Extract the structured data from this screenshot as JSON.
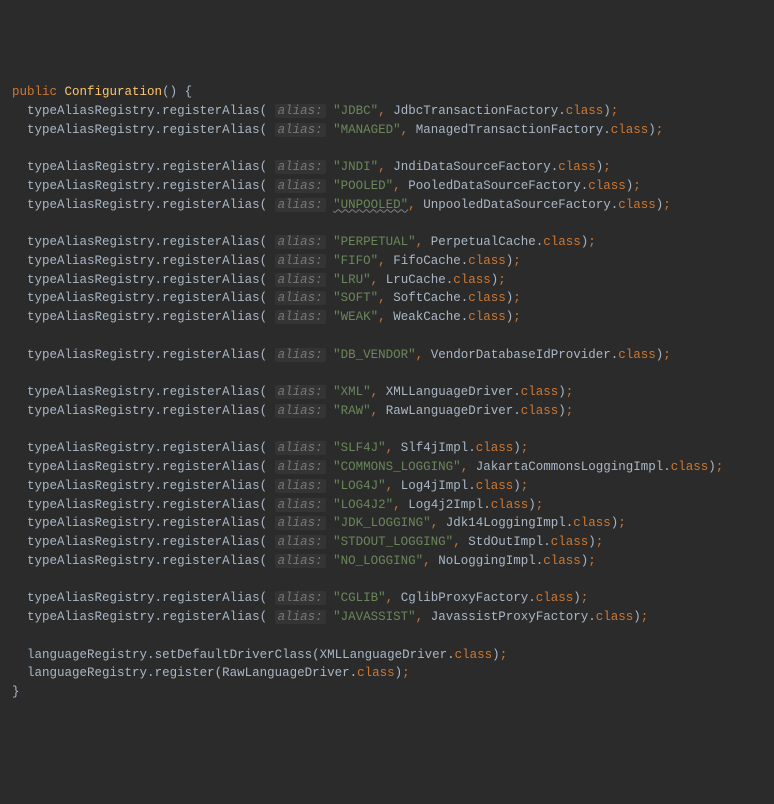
{
  "keywords": {
    "public": "public",
    "class": "class"
  },
  "method": "Configuration",
  "registry": "typeAliasRegistry",
  "langRegistry": "languageRegistry",
  "registerAlias": "registerAlias",
  "setDefaultDriverClass": "setDefaultDriverClass",
  "register": "register",
  "hint": "alias:",
  "lines": [
    {
      "alias": "JDBC",
      "cls": "JdbcTransactionFactory"
    },
    {
      "alias": "MANAGED",
      "cls": "ManagedTransactionFactory"
    },
    null,
    {
      "alias": "JNDI",
      "cls": "JndiDataSourceFactory"
    },
    {
      "alias": "POOLED",
      "cls": "PooledDataSourceFactory"
    },
    {
      "alias": "UNPOOLED",
      "cls": "UnpooledDataSourceFactory",
      "underline": true
    },
    null,
    {
      "alias": "PERPETUAL",
      "cls": "PerpetualCache"
    },
    {
      "alias": "FIFO",
      "cls": "FifoCache"
    },
    {
      "alias": "LRU",
      "cls": "LruCache"
    },
    {
      "alias": "SOFT",
      "cls": "SoftCache"
    },
    {
      "alias": "WEAK",
      "cls": "WeakCache"
    },
    null,
    {
      "alias": "DB_VENDOR",
      "cls": "VendorDatabaseIdProvider"
    },
    null,
    {
      "alias": "XML",
      "cls": "XMLLanguageDriver"
    },
    {
      "alias": "RAW",
      "cls": "RawLanguageDriver"
    },
    null,
    {
      "alias": "SLF4J",
      "cls": "Slf4jImpl"
    },
    {
      "alias": "COMMONS_LOGGING",
      "cls": "JakartaCommonsLoggingImpl"
    },
    {
      "alias": "LOG4J",
      "cls": "Log4jImpl"
    },
    {
      "alias": "LOG4J2",
      "cls": "Log4j2Impl"
    },
    {
      "alias": "JDK_LOGGING",
      "cls": "Jdk14LoggingImpl"
    },
    {
      "alias": "STDOUT_LOGGING",
      "cls": "StdOutImpl"
    },
    {
      "alias": "NO_LOGGING",
      "cls": "NoLoggingImpl"
    },
    null,
    {
      "alias": "CGLIB",
      "cls": "CglibProxyFactory"
    },
    {
      "alias": "JAVASSIST",
      "cls": "JavassistProxyFactory"
    }
  ],
  "tail": [
    {
      "call": "setDefaultDriverClass",
      "cls": "XMLLanguageDriver"
    },
    {
      "call": "register",
      "cls": "RawLanguageDriver"
    }
  ]
}
